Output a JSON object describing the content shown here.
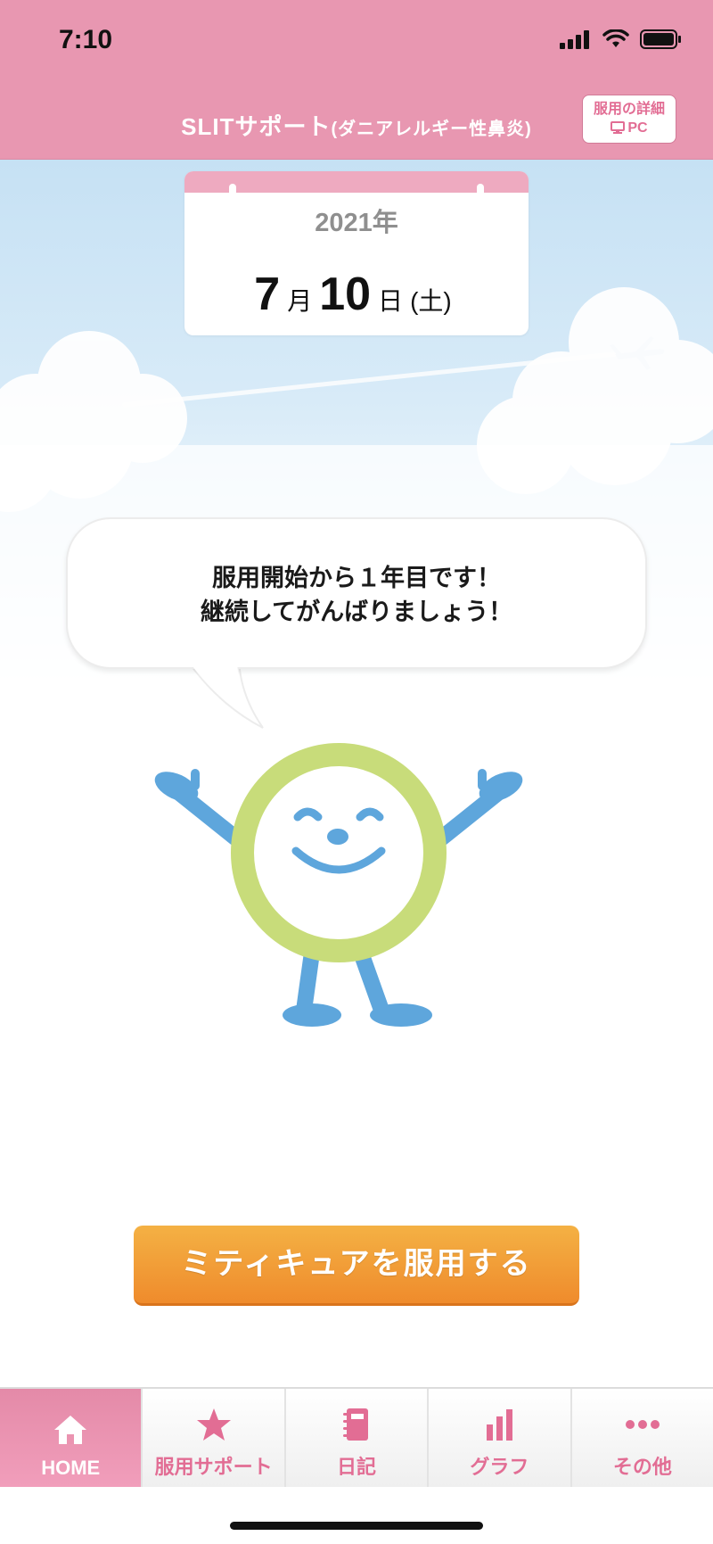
{
  "status": {
    "time": "7:10"
  },
  "header": {
    "title_main": "SLITサポート",
    "title_sub": "(ダニアレルギー性鼻炎)",
    "pc_button_line1": "服用の詳細",
    "pc_button_line2": "PC"
  },
  "calendar": {
    "year": "2021年",
    "month": "7",
    "month_unit": "月",
    "day": "10",
    "day_unit": "日",
    "weekday": "(土)"
  },
  "message": {
    "line1": "服用開始から１年目です！",
    "line2": "継続してがんばりましょう！"
  },
  "cta": {
    "label": "ミティキュアを服用する"
  },
  "tabs": [
    {
      "label": "HOME",
      "icon": "home-icon"
    },
    {
      "label": "服用サポート",
      "icon": "star-icon"
    },
    {
      "label": "日記",
      "icon": "notebook-icon"
    },
    {
      "label": "グラフ",
      "icon": "bar-chart-icon"
    },
    {
      "label": "その他",
      "icon": "more-dots-icon"
    }
  ],
  "colors": {
    "header_pink": "#e897b1",
    "accent_pink": "#e26d94",
    "cta_orange": "#ef8b2c",
    "mascot_green": "#c8dc7a",
    "mascot_blue": "#5ea6dc"
  }
}
